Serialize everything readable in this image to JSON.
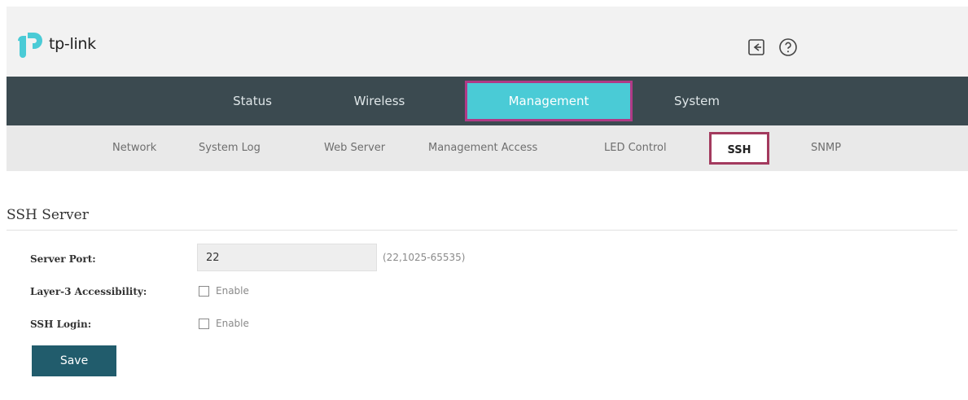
{
  "header": {
    "logo_text": "tp-link",
    "brand_color": "#4acbd6",
    "icons": [
      "logout-icon",
      "help-icon"
    ]
  },
  "topnav": {
    "items": [
      {
        "label": "Status",
        "active": false
      },
      {
        "label": "Wireless",
        "active": false
      },
      {
        "label": "Management",
        "active": true
      },
      {
        "label": "System",
        "active": false
      }
    ],
    "background": "#3b4a50",
    "active_color": "#4acbd6"
  },
  "subnav": {
    "items": [
      {
        "label": "Network",
        "active": false
      },
      {
        "label": "System Log",
        "active": false
      },
      {
        "label": "Web Server",
        "active": false
      },
      {
        "label": "Management Access",
        "active": false
      },
      {
        "label": "LED Control",
        "active": false
      },
      {
        "label": "SSH",
        "active": true
      },
      {
        "label": "SNMP",
        "active": false
      }
    ]
  },
  "section": {
    "title": "SSH Server"
  },
  "form": {
    "server_port": {
      "label": "Server Port:",
      "value": "22",
      "hint": "(22,1025-65535)"
    },
    "layer3": {
      "label": "Layer-3 Accessibility:",
      "checkbox_label": "Enable",
      "checked": false
    },
    "ssh_login": {
      "label": "SSH Login:",
      "checkbox_label": "Enable",
      "checked": false
    },
    "save_label": "Save",
    "save_color": "#215c6c"
  }
}
